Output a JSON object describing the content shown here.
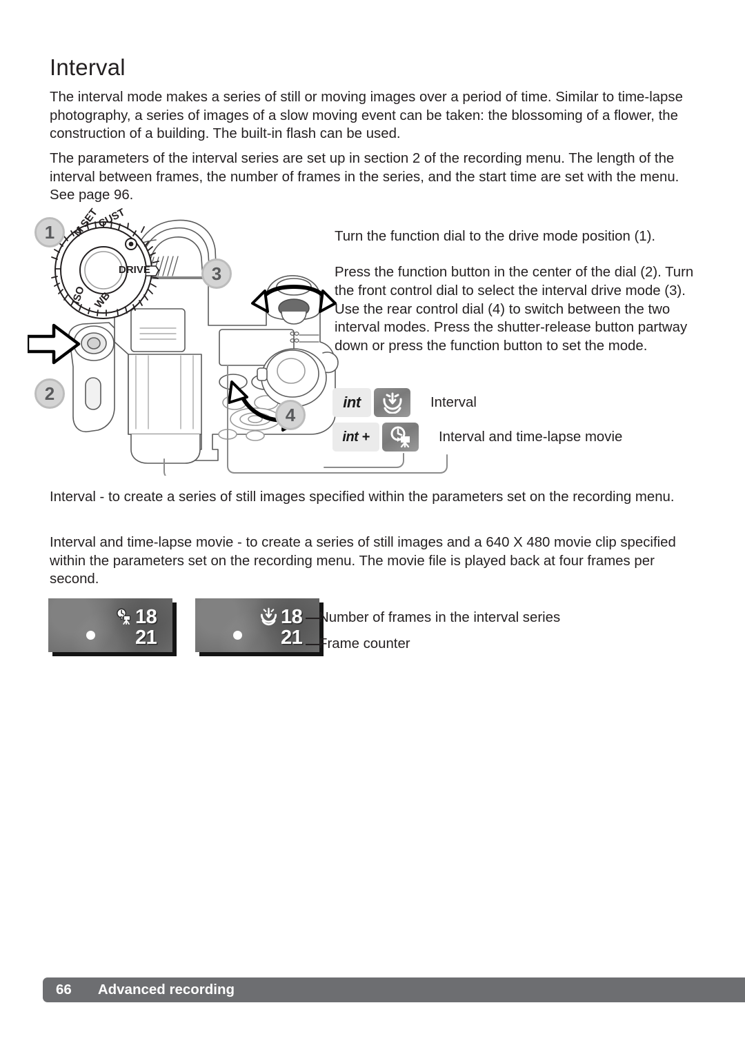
{
  "page": {
    "title": "Interval",
    "number": "66",
    "section": "Advanced recording"
  },
  "body": {
    "intro": "The interval mode makes a series of still or moving images over a period of time. Similar to time-lapse photography, a series of images of a slow moving event can be taken: the blossoming of a flower, the construction of a building. The built-in flash can be used.",
    "parameters": "The parameters of the interval series are set up in section 2 of the recording menu. The length of the interval between frames, the number of frames in the series, and the start time are set with the menu. See page 96.",
    "interval_def": "Interval - to create a series of still images specified within the parameters set on the recording menu.",
    "timelapse_def": "Interval and time-lapse movie - to create a series of still images and a 640 X 480 movie clip specified within the parameters set on the recording menu. The movie file is played back at four frames per second."
  },
  "instructions": {
    "step_a": "Turn the function dial to the drive mode position (1).",
    "step_b": "Press the function button in the center of the dial (2). Turn the front control dial to select the interval drive mode (3). Use the rear control dial (4) to switch between the two interval modes. Press the shutter-release button partway down or press the function button to set the mode."
  },
  "callouts": [
    {
      "id": "1",
      "label": "1"
    },
    {
      "id": "2",
      "label": "2"
    },
    {
      "id": "3",
      "label": "3"
    },
    {
      "id": "4",
      "label": "4"
    }
  ],
  "function_dial": {
    "labels": [
      "M SET",
      "CUST",
      "DRIVE",
      "WB",
      "ISO"
    ],
    "center_dot_icon": "self-timer-dot-icon"
  },
  "drive_modes": [
    {
      "code": "int",
      "icon": "interval-timer-icon",
      "label": "Interval"
    },
    {
      "code": "int +",
      "icon": "interval-movie-icon",
      "label": "Interval and time-lapse movie"
    }
  ],
  "lcd_panels": [
    {
      "name": "interval-and-movie-display",
      "badge_icon": "interval-movie-icon",
      "frames": "18",
      "counter": "21",
      "focus_dot": "focus-signal-dot"
    },
    {
      "name": "interval-display",
      "badge_icon": "interval-timer-icon",
      "frames": "18",
      "counter": "21",
      "focus_dot": "focus-signal-dot"
    }
  ],
  "lcd_annotations": {
    "frames": "Number of frames in the interval series",
    "counter": "Frame counter"
  },
  "colors": {
    "footer_bar": "#6d6e71",
    "callout_fill": "#d4d4d4",
    "callout_ring": "#bcbcbc",
    "text": "#231f20",
    "lcd_background": "#6e6e6e"
  }
}
